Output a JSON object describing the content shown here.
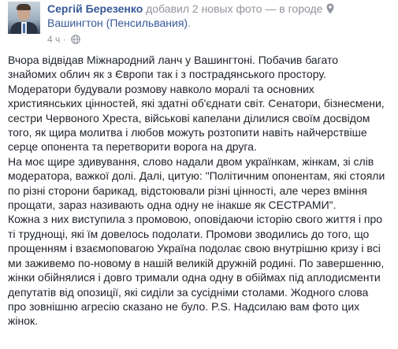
{
  "post": {
    "author": "Сергій Березенко",
    "action": "добавил 2 новых фото — в городе",
    "location": "Вашингтон (Пенсильвания)",
    "location_suffix": ".",
    "time": "4 ч",
    "time_separator": "·",
    "icons": {
      "location": "location-pin-icon",
      "audience": "globe-icon"
    },
    "colors": {
      "link": "#365899",
      "meta": "#90949c",
      "text": "#1d2129"
    },
    "body_lines": [
      "Вчора відвідав Міжнародний ланч у Вашингтоні. Побачив багато",
      "знайомих облич як з Європи так і з пострадянського простору.",
      "Модератори будували розмову навколо моралі та основних",
      "християнських цінностей, які здатні об'єднати світ. Сенатори, бізнесмени,",
      "сестри Червоного Хреста, військові капелани ділилися своїм досвідом",
      "того, як щира молитва і любов можуть розтопити навіть найчерствіше",
      "серце опонента та перетворити ворога на друга.",
      "На моє щире здивування, слово надали двом українкам, жінкам, зі слів",
      "модератора, важкої долі. Далі, цитую: \"Політичним опонентам, які стояли",
      "по різні сторони барикад, відстоювали різні цінності, але через вміння",
      "прощати, зараз називають одна одну не інакше як СЕСТРАМИ\".",
      "Кожна з них виступила з промовою, оповідаючи історію свого життя і про",
      "ті труднощі, які їм довелось подолати. Промови зводились до того, що",
      "прощенням і взаємоповагою Україна подолає свою внутрішню кризу і всі",
      "ми заживемо по-новому в нашій великій дружній родині. По завершенню,",
      "жінки обійнялися і довго тримали одна одну в обіймах під аплодисменти",
      "депутатів від опозиції, які сиділи за сусідніми столами. Жодного слова",
      "про зовнішню агресію сказано не було. P.S. Надсилаю вам фото цих",
      "жінок."
    ]
  }
}
